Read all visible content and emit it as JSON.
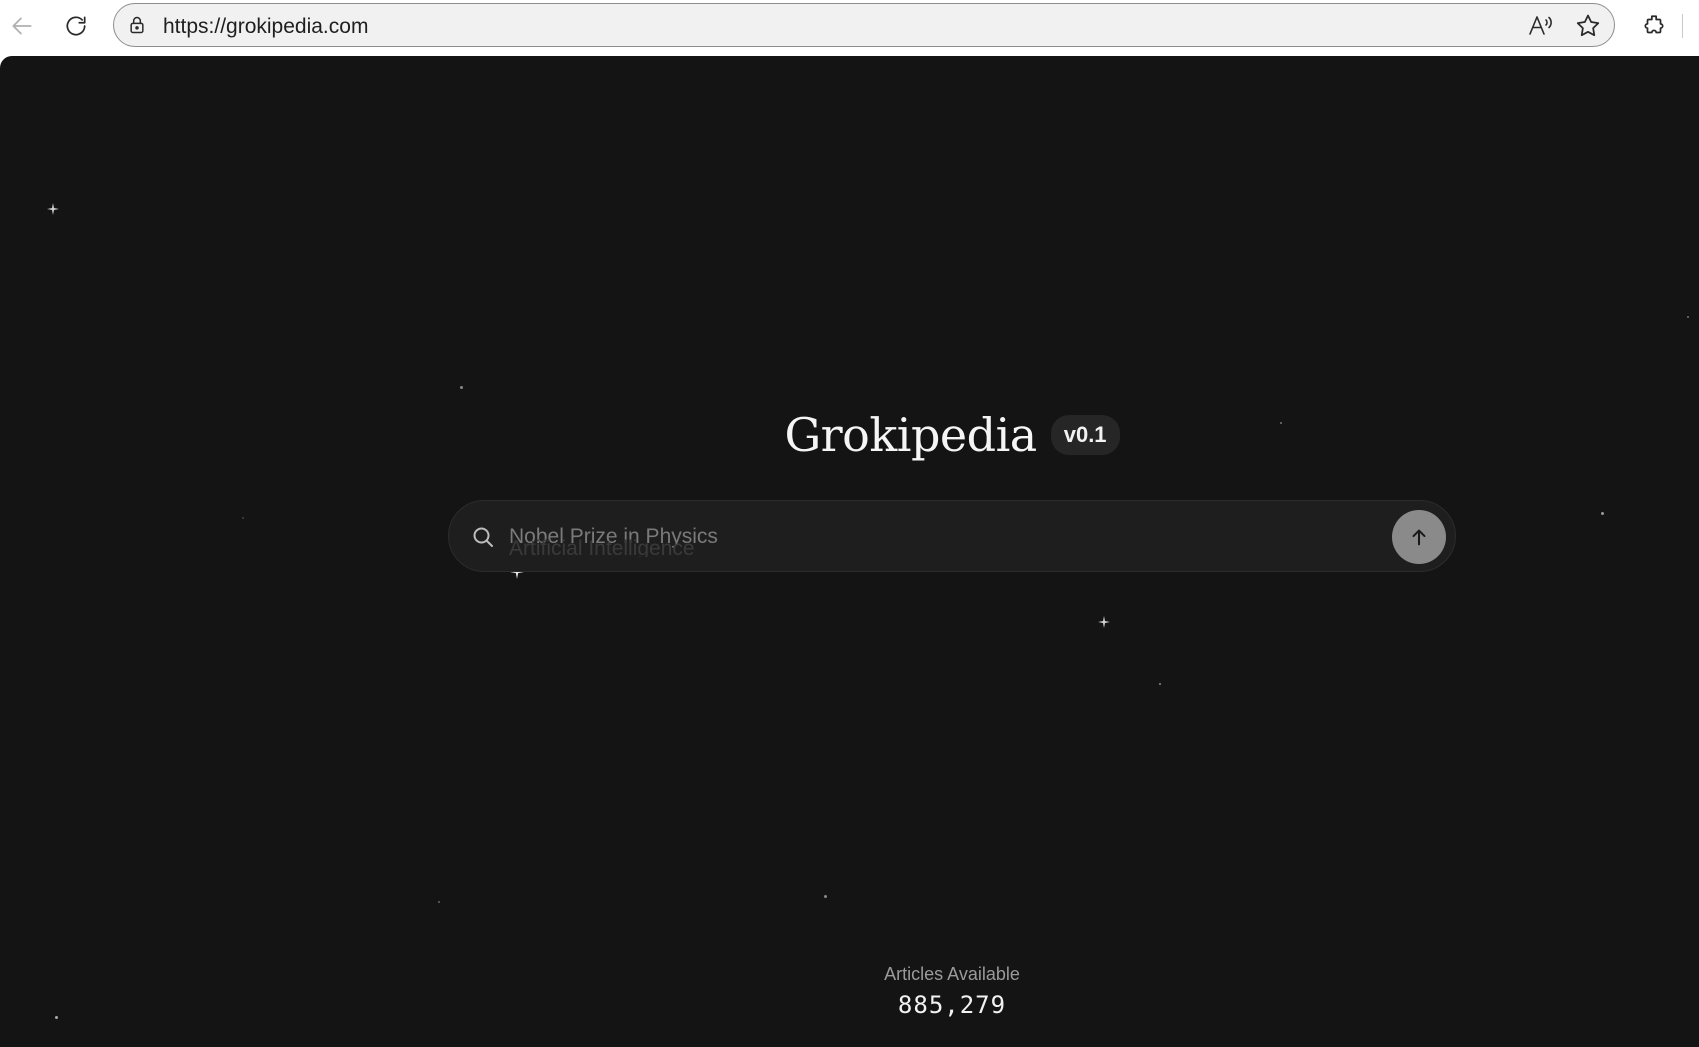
{
  "browser": {
    "url": "https://grokipedia.com",
    "icons": [
      "back-icon",
      "refresh-icon",
      "lock-icon",
      "read-aloud-icon",
      "favorite-star-icon",
      "extensions-icon"
    ]
  },
  "hero": {
    "title": "Grokipedia",
    "version": "v0.1"
  },
  "search": {
    "placeholder": "Nobel Prize in Physics",
    "ghost_placeholder": "Artificial Intelligence"
  },
  "stats": {
    "label": "Articles Available",
    "count": "885,279"
  },
  "colors": {
    "page_background": "#141414",
    "search_background": "#1e1e1e",
    "submit_button": "#8a8a8a",
    "title_text": "#f5f5f5"
  }
}
